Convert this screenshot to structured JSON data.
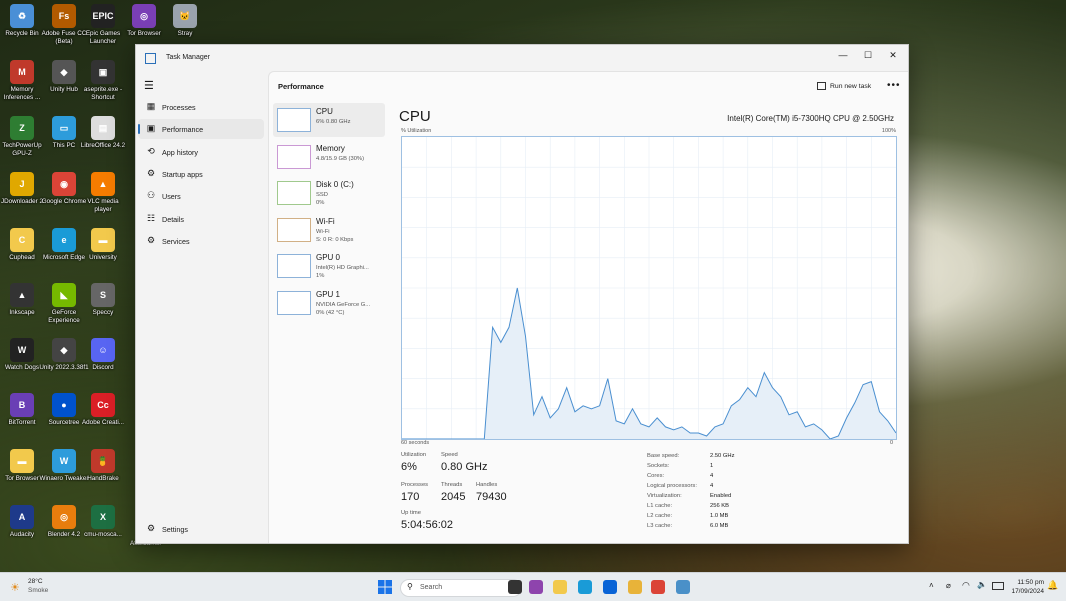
{
  "desktop": {
    "icons": [
      {
        "label": "Recycle Bin",
        "col": 0,
        "row": 0,
        "color": "#4a8fd6",
        "glyph": "♻"
      },
      {
        "label": "Adobe Fuse CC (Beta)",
        "col": 1,
        "row": 0,
        "color": "#b25a00",
        "glyph": "Fs"
      },
      {
        "label": "Epic Games Launcher",
        "col": 2,
        "row": 0,
        "color": "#222222",
        "glyph": "EPIC"
      },
      {
        "label": "Tor Browser",
        "col": 3,
        "row": 0,
        "color": "#7a3fb5",
        "glyph": "◎"
      },
      {
        "label": "Stray",
        "col": 4,
        "row": 0,
        "color": "#9aa3ad",
        "glyph": "🐱"
      },
      {
        "label": "Memory Inferences ...",
        "col": 0,
        "row": 1,
        "color": "#c0392b",
        "glyph": "M"
      },
      {
        "label": "Unity Hub",
        "col": 1,
        "row": 1,
        "color": "#555555",
        "glyph": "◆"
      },
      {
        "label": "aseprite.exe - Shortcut",
        "col": 2,
        "row": 1,
        "color": "#333333",
        "glyph": "▣"
      },
      {
        "label": "TechPowerUp GPU-Z",
        "col": 0,
        "row": 2,
        "color": "#2e7d32",
        "glyph": "Z"
      },
      {
        "label": "This PC",
        "col": 1,
        "row": 2,
        "color": "#2d9cdb",
        "glyph": "▭"
      },
      {
        "label": "LibreOffice 24.2",
        "col": 2,
        "row": 2,
        "color": "#dddddd",
        "glyph": "▤"
      },
      {
        "label": "JDownloader 2",
        "col": 0,
        "row": 3,
        "color": "#e0a800",
        "glyph": "J"
      },
      {
        "label": "Google Chrome",
        "col": 1,
        "row": 3,
        "color": "#db4437",
        "glyph": "◉"
      },
      {
        "label": "VLC media player",
        "col": 2,
        "row": 3,
        "color": "#f57c00",
        "glyph": "▲"
      },
      {
        "label": "Cuphead",
        "col": 0,
        "row": 4,
        "color": "#f2c94c",
        "glyph": "C"
      },
      {
        "label": "Microsoft Edge",
        "col": 1,
        "row": 4,
        "color": "#1a9bd7",
        "glyph": "e"
      },
      {
        "label": "University",
        "col": 2,
        "row": 4,
        "color": "#f2c94c",
        "glyph": "▬"
      },
      {
        "label": "Inkscape",
        "col": 0,
        "row": 5,
        "color": "#333333",
        "glyph": "▲"
      },
      {
        "label": "GeForce Experience",
        "col": 1,
        "row": 5,
        "color": "#76b900",
        "glyph": "◣"
      },
      {
        "label": "Speccy",
        "col": 2,
        "row": 5,
        "color": "#666666",
        "glyph": "S"
      },
      {
        "label": "Watch Dogs",
        "col": 0,
        "row": 6,
        "color": "#222222",
        "glyph": "W"
      },
      {
        "label": "Unity 2022.3.38f1",
        "col": 1,
        "row": 6,
        "color": "#444444",
        "glyph": "◆"
      },
      {
        "label": "Discord",
        "col": 2,
        "row": 6,
        "color": "#5865f2",
        "glyph": "☺"
      },
      {
        "label": "BitTorrent",
        "col": 0,
        "row": 7,
        "color": "#6a3fb5",
        "glyph": "B"
      },
      {
        "label": "Sourcetree",
        "col": 1,
        "row": 7,
        "color": "#0052cc",
        "glyph": "●"
      },
      {
        "label": "Adobe Creati...",
        "col": 2,
        "row": 7,
        "color": "#da1f26",
        "glyph": "Cc"
      },
      {
        "label": "Tor Browser",
        "col": 0,
        "row": 8,
        "color": "#f2c94c",
        "glyph": "▬"
      },
      {
        "label": "Winaero Tweaker",
        "col": 1,
        "row": 8,
        "color": "#2d9cdb",
        "glyph": "W"
      },
      {
        "label": "HandBrake",
        "col": 2,
        "row": 8,
        "color": "#c0392b",
        "glyph": "🍍"
      },
      {
        "label": "Audacity",
        "col": 0,
        "row": 9,
        "color": "#1e3a8a",
        "glyph": "A"
      },
      {
        "label": "Blender 4.2",
        "col": 1,
        "row": 9,
        "color": "#e87d0d",
        "glyph": "◎"
      },
      {
        "label": "cmu-mosca...",
        "col": 2,
        "row": 9,
        "color": "#1d6f42",
        "glyph": "X"
      }
    ],
    "afterburner_label": "Afterburner"
  },
  "window": {
    "title": "Task Manager",
    "minimize": "—",
    "maximize": "☐",
    "close": "✕"
  },
  "sidebar": {
    "menu_icon": "☰",
    "items": [
      {
        "label": "Processes",
        "icon": "▦",
        "active": false
      },
      {
        "label": "Performance",
        "icon": "▣",
        "active": true
      },
      {
        "label": "App history",
        "icon": "⟲",
        "active": false
      },
      {
        "label": "Startup apps",
        "icon": "⚙",
        "active": false
      },
      {
        "label": "Users",
        "icon": "⚇",
        "active": false
      },
      {
        "label": "Details",
        "icon": "☷",
        "active": false
      },
      {
        "label": "Services",
        "icon": "⚙",
        "active": false
      }
    ],
    "settings": "Settings",
    "settings_icon": "⚙"
  },
  "header": {
    "title": "Performance",
    "run_new_task": "Run new task",
    "more": "•••"
  },
  "perf_list": [
    {
      "name": "CPU",
      "sub1": "6% 0.80 GHz",
      "sub2": "",
      "active": true,
      "color": "#2a6fb8"
    },
    {
      "name": "Memory",
      "sub1": "4.8/15.9 GB (30%)",
      "sub2": "",
      "active": false,
      "color": "#9b3fae"
    },
    {
      "name": "Disk 0 (C:)",
      "sub1": "SSD",
      "sub2": "0%",
      "active": false,
      "color": "#4c9a2a"
    },
    {
      "name": "Wi-Fi",
      "sub1": "Wi-Fi",
      "sub2": "S: 0 R: 0 Kbps",
      "active": false,
      "color": "#a86a1c"
    },
    {
      "name": "GPU 0",
      "sub1": "Intel(R) HD Graphi...",
      "sub2": "1%",
      "active": false,
      "color": "#2a6fb8"
    },
    {
      "name": "GPU 1",
      "sub1": "NVIDIA GeForce G...",
      "sub2": "0% (42 °C)",
      "active": false,
      "color": "#2a6fb8"
    }
  ],
  "detail": {
    "title": "CPU",
    "model": "Intel(R) Core(TM) i5-7300HQ CPU @ 2.50GHz",
    "y_label": "% Utilization",
    "y_max": "100%",
    "x_left": "60 seconds",
    "x_right": "0",
    "utilization_label": "Utilization",
    "utilization": "6%",
    "speed_label": "Speed",
    "speed": "0.80 GHz",
    "processes_label": "Processes",
    "processes": "170",
    "threads_label": "Threads",
    "threads": "2045",
    "handles_label": "Handles",
    "handles": "79430",
    "uptime_label": "Up time",
    "uptime": "5:04:56:02",
    "specs": [
      {
        "k": "Base speed:",
        "v": "2.50 GHz"
      },
      {
        "k": "Sockets:",
        "v": "1"
      },
      {
        "k": "Cores:",
        "v": "4"
      },
      {
        "k": "Logical processors:",
        "v": "4"
      },
      {
        "k": "Virtualization:",
        "v": "Enabled"
      },
      {
        "k": "L1 cache:",
        "v": "256 KB"
      },
      {
        "k": "L2 cache:",
        "v": "1.0 MB"
      },
      {
        "k": "L3 cache:",
        "v": "6.0 MB"
      }
    ]
  },
  "chart_data": {
    "type": "area",
    "title": "CPU",
    "xlabel": "60 seconds",
    "ylabel": "% Utilization",
    "xlim": [
      60,
      0
    ],
    "ylim": [
      0,
      100
    ],
    "grid": true,
    "series": [
      {
        "values": [
          0,
          0,
          0,
          0,
          0,
          0,
          0,
          0,
          0,
          0,
          0,
          0,
          0,
          0,
          0,
          0,
          0,
          0,
          0,
          0,
          0,
          0,
          0,
          0,
          0,
          0,
          0,
          0,
          0,
          0,
          0,
          0,
          0,
          0,
          0,
          0,
          0,
          0,
          0,
          0,
          0,
          0,
          0,
          0,
          0,
          0,
          0,
          0,
          0,
          0,
          0,
          0,
          0,
          0,
          0,
          0,
          0,
          0,
          0,
          0,
          0
        ]
      }
    ],
    "cpu_values": [
      0,
      0,
      0,
      0,
      0,
      0,
      0,
      0,
      0,
      0,
      0,
      37,
      32,
      37,
      50,
      34,
      8,
      14,
      7,
      10,
      17,
      9,
      11,
      10,
      11,
      20,
      6,
      5,
      10,
      5,
      4,
      7,
      4,
      3,
      4,
      2,
      2,
      1,
      4,
      5,
      11,
      13,
      17,
      14,
      22,
      17,
      14,
      8,
      9,
      4,
      5,
      3,
      0,
      1,
      7,
      12,
      18,
      19,
      9,
      6,
      2
    ]
  },
  "taskbar": {
    "weather_temp": "28°C",
    "weather_desc": "Smoke",
    "search_placeholder": "Search",
    "time": "11:50 pm",
    "date": "17/09/2024",
    "apps": [
      {
        "name": "start-button",
        "color": "#1a73e8"
      },
      {
        "name": "task-view",
        "color": "#333333"
      },
      {
        "name": "widgets",
        "color": "#8e44ad"
      },
      {
        "name": "file-explorer",
        "color": "#f2c94c"
      },
      {
        "name": "edge",
        "color": "#1a9bd7"
      },
      {
        "name": "store",
        "color": "#0a64d6"
      },
      {
        "name": "folder",
        "color": "#e8b339"
      },
      {
        "name": "chrome",
        "color": "#db4437"
      },
      {
        "name": "task-manager",
        "color": "#4a90c8"
      }
    ]
  }
}
